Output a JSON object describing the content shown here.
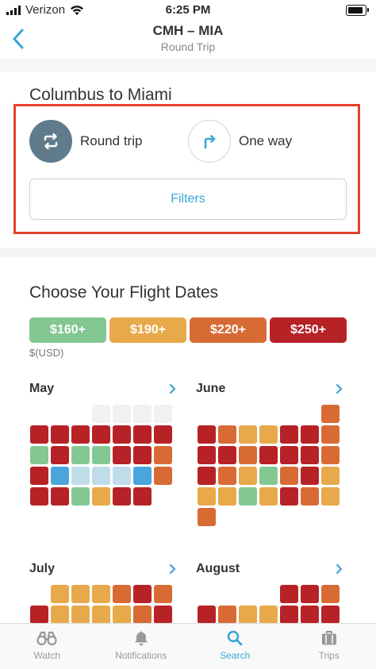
{
  "status_bar": {
    "carrier": "Verizon",
    "time": "6:25 PM"
  },
  "nav": {
    "title": "CMH – MIA",
    "subtitle": "Round Trip"
  },
  "route": {
    "title": "Columbus to Miami",
    "options": [
      {
        "label": "Round trip",
        "selected": true,
        "icon": "round-trip-icon"
      },
      {
        "label": "One way",
        "selected": false,
        "icon": "one-way-icon"
      }
    ],
    "filters_label": "Filters"
  },
  "dates": {
    "title": "Choose Your Flight Dates",
    "legend": [
      {
        "label": "$160+",
        "color": "#83c793"
      },
      {
        "label": "$190+",
        "color": "#e8a94a"
      },
      {
        "label": "$220+",
        "color": "#d86b34"
      },
      {
        "label": "$250+",
        "color": "#b72227"
      }
    ],
    "currency": "$(USD)",
    "colors": {
      "R": "#b72227",
      "O": "#d86b34",
      "Y": "#e8a94a",
      "G": "#83c793",
      "B": "#4aa5dc",
      "L": "#bfdde9",
      "E": "#f1f1f1"
    },
    "months": [
      {
        "name": "May",
        "rows": [
          "___EEEE",
          "RRRRRRR",
          "GRGGRRO",
          "RBLLLBO",
          "RRGYRR_"
        ]
      },
      {
        "name": "June",
        "rows": [
          "______O",
          "ROYYRRO",
          "RRORRRO",
          "ROYGORY",
          "YYGYROY",
          "O______"
        ]
      },
      {
        "name": "July",
        "rows": [
          "_YYYORO",
          "RYYYYOR"
        ]
      },
      {
        "name": "August",
        "rows": [
          "____RRO",
          "ROYYRRR"
        ]
      }
    ]
  },
  "tabbar": {
    "tabs": [
      {
        "label": "Watch",
        "icon": "binoculars-icon",
        "active": false
      },
      {
        "label": "Notifications",
        "icon": "bell-icon",
        "active": false
      },
      {
        "label": "Search",
        "icon": "search-icon",
        "active": true
      },
      {
        "label": "Trips",
        "icon": "suitcase-icon",
        "active": false
      }
    ]
  }
}
